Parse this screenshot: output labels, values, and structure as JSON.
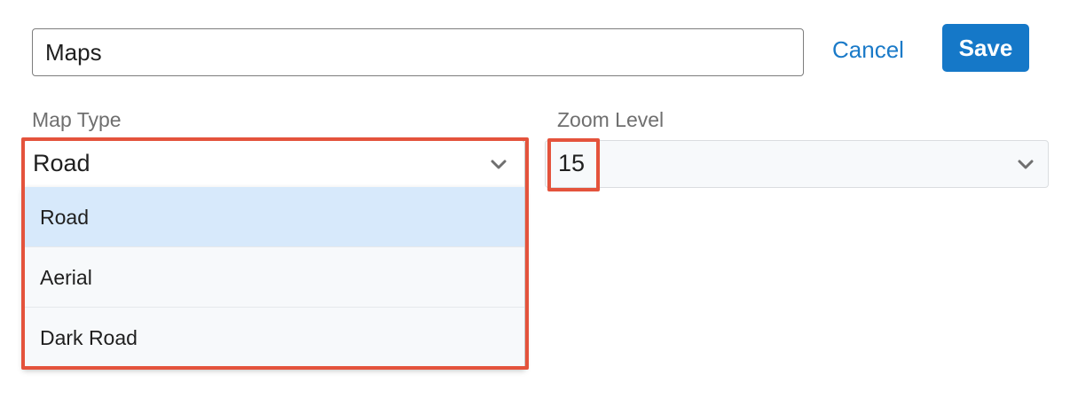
{
  "form": {
    "name_value": "Maps",
    "cancel_label": "Cancel",
    "save_label": "Save"
  },
  "map_type": {
    "label": "Map Type",
    "selected": "Road",
    "options": [
      "Road",
      "Aerial",
      "Dark Road"
    ]
  },
  "zoom_level": {
    "label": "Zoom Level",
    "selected": "15"
  },
  "icons": {
    "dropdown": "chevron-down-icon"
  },
  "colors": {
    "accent": "#1578c8",
    "link": "#1a7ac8",
    "highlight": "#e4533c",
    "option_selected_bg": "#d7e9fb"
  }
}
